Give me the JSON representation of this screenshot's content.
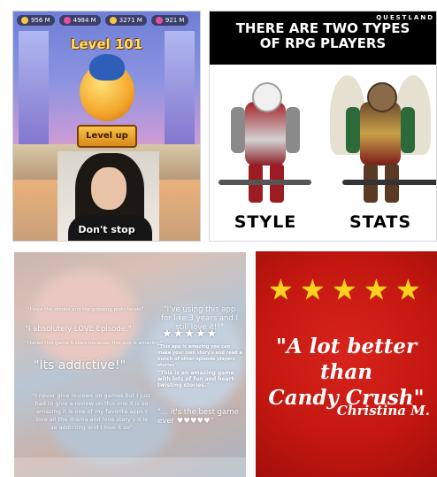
{
  "tile_game": {
    "hud": [
      {
        "value": "956 M",
        "icon": "coin-icon",
        "color": "#f5c842"
      },
      {
        "value": "4984 M",
        "icon": "gem-icon",
        "color": "#e64fa0"
      },
      {
        "value": "3271 M",
        "icon": "coin-icon",
        "color": "#f5c842"
      },
      {
        "value": "921 M",
        "icon": "gem-icon",
        "color": "#e64fa0"
      }
    ],
    "banner": "Level 101",
    "level_button": "Level up",
    "caption": "Don't stop"
  },
  "tile_rpg": {
    "brand": "QUESTLAND",
    "headline_line1": "THERE ARE TWO TYPES",
    "headline_line2": "OF RPG PLAYERS",
    "left_label": "STYLE",
    "right_label": "STATS"
  },
  "tile_reviews": {
    "r1": "\"I love the stories and the gripping plots twists\"",
    "r2": "\"I absolutely LOVE Episode.\"",
    "r3": "\"I rated this game 5 stars because, this app is amazing!\"",
    "r4": "\"Its addictive!\"",
    "r5": "\"I never give reviews on games but I just had to give a review on this one it is so amazing it is one of my favorite apps I love all the drama and love story's it is so addicting and I love it so\"",
    "r6": "\"I've using this app for like 3 years and I still love it!!\"",
    "stars": "★★★★★",
    "r7": "\"This app is amazing you can make your own story's and read a bunch of other episode players stories\"",
    "r8": "\"This is an amazing game with lots of fun and heart-twisting stories.\"",
    "r9": "\"... it's the best game ever ♥♥♥♥♥\""
  },
  "tile_quote": {
    "stars": [
      "★",
      "★",
      "★",
      "★",
      "★"
    ],
    "line1": "\"A lot better than",
    "line2": "Candy Crush\"",
    "author": "Christina M."
  }
}
